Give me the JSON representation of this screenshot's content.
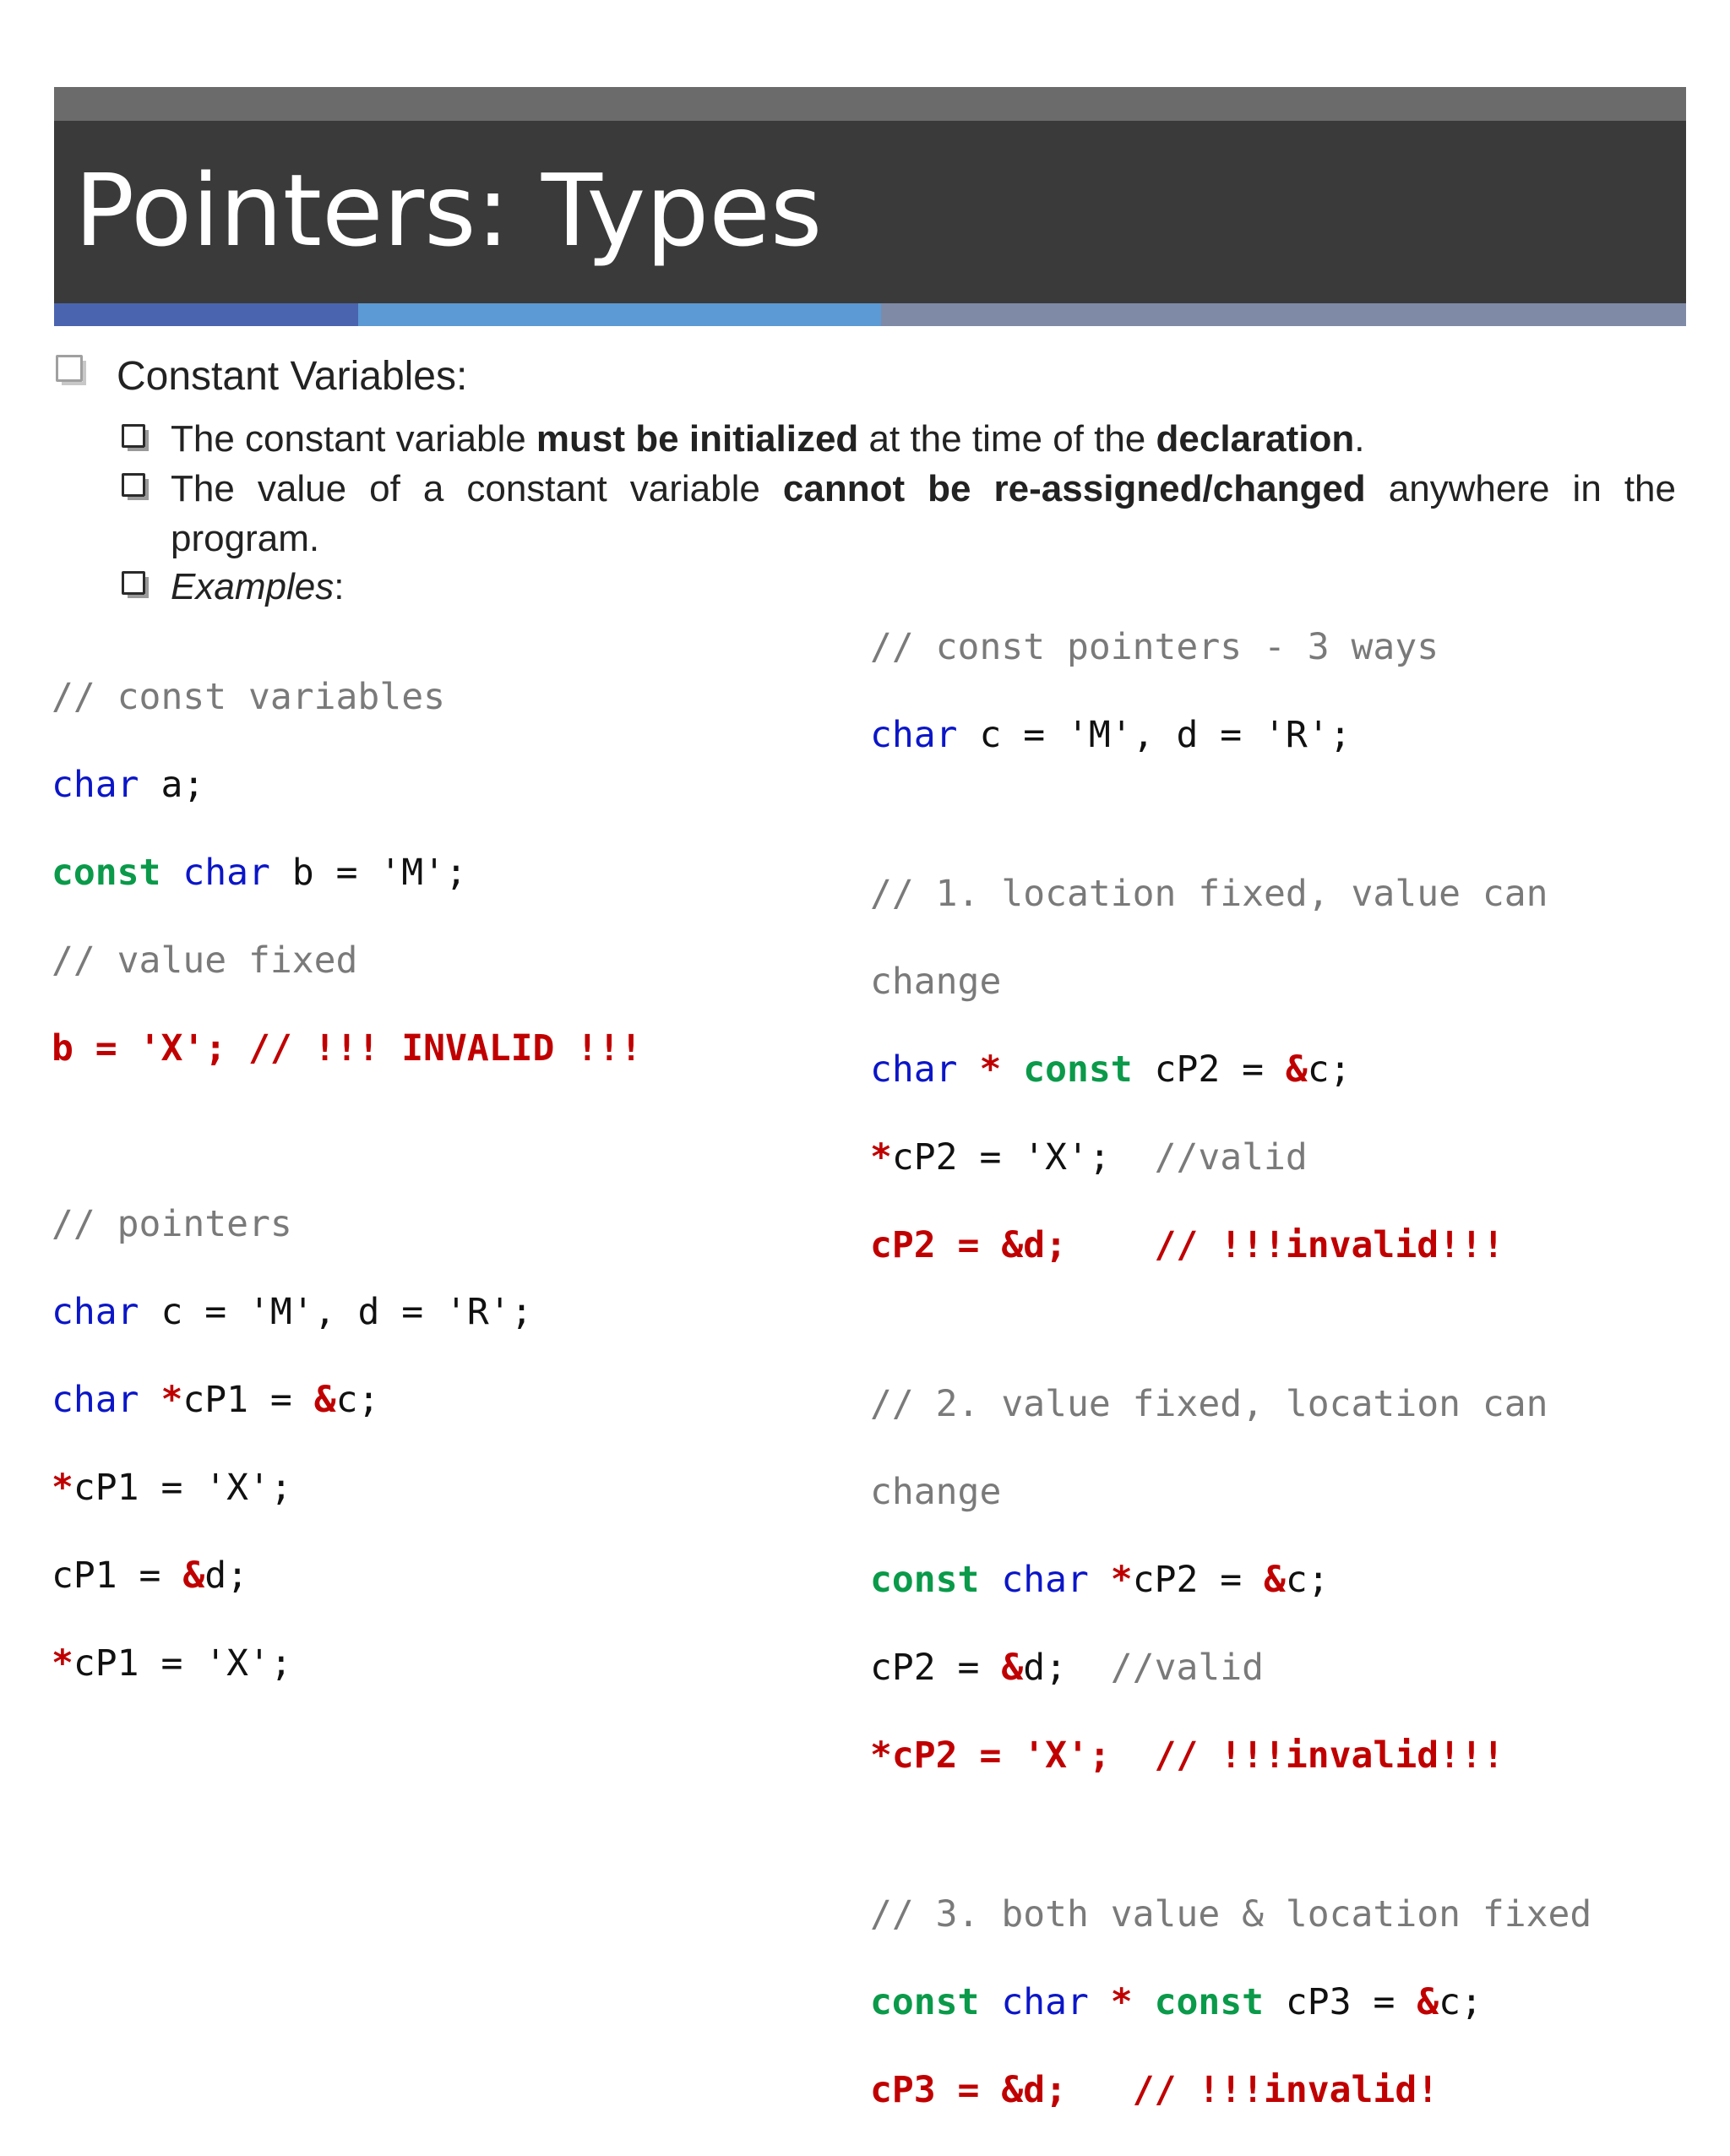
{
  "title": "Pointers: Types",
  "colors": {
    "title_bar": "#3a3a3a",
    "top_band": "#6b6b6b",
    "stripe_1": "#4a64b0",
    "stripe_2": "#5b9ad4",
    "stripe_3": "#7e8aa6",
    "keyword": "#0b16c8",
    "qualifier": "#0a9a4a",
    "error": "#c00000",
    "comment": "#7a7a7a"
  },
  "bullets": {
    "level1": "Constant Variables:",
    "b1": {
      "pre": "The constant variable ",
      "bold1": "must be initialized",
      "mid": " at the time of the ",
      "bold2": "declaration",
      "post": "."
    },
    "b2": {
      "pre": "The value of a constant variable ",
      "bold": "cannot be re-assigned/changed",
      "post": " anywhere in the",
      "line2": "program."
    },
    "b3": {
      "em": "Examples",
      "post": ":"
    }
  },
  "left_code": {
    "c1": "// const variables",
    "l1_kw": "char",
    "l1_rest": " a;",
    "l2_kg": "const",
    "l2_kw": "char",
    "l2_rest": " b = 'M';",
    "c2": "// value fixed",
    "l3_red": "b = 'X'; // !!! INVALID !!!",
    "c3": "// pointers",
    "l4_kw": "char",
    "l4_rest": " c = 'M', d = 'R';",
    "l5_kw": "char",
    "l5_star": "*",
    "l5_mid": "cP1 = ",
    "l5_amp": "&",
    "l5_end": "c;",
    "l6_star": "*",
    "l6_rest": "cP1 = 'X';",
    "l7_pre": "cP1 = ",
    "l7_amp": "&",
    "l7_end": "d;",
    "l8_star": "*",
    "l8_rest": "cP1 = 'X';"
  },
  "right_code": {
    "c1": "// const pointers - 3 ways",
    "r1_kw": "char",
    "r1_rest": " c = 'M', d = 'R';",
    "c2a": "// 1. location fixed, value can",
    "c2b": "change",
    "r2_kw": "char",
    "r2_star": "*",
    "r2_kg": "const",
    "r2_mid": " cP2 = ",
    "r2_amp": "&",
    "r2_end": "c;",
    "r3_star": "*",
    "r3_rest": "cP2 = 'X';  ",
    "r3_cm": "//valid",
    "r4_red": "cP2 = &d;    // !!!invalid!!!",
    "c3a": "// 2. value fixed, location can",
    "c3b": "change",
    "r5_kg": "const",
    "r5_kw": "char",
    "r5_star": "*",
    "r5_mid": "cP2 = ",
    "r5_amp": "&",
    "r5_end": "c;",
    "r6_pre": "cP2 = ",
    "r6_amp": "&",
    "r6_end": "d;  ",
    "r6_cm": "//valid",
    "r7_red": "*cP2 = 'X';  // !!!invalid!!!",
    "c4": "// 3. both value & location fixed",
    "r8_kg": "const",
    "r8_kw": "char",
    "r8_star": "*",
    "r8_kg2": "const",
    "r8_mid": " cP3 = ",
    "r8_amp": "&",
    "r8_end": "c;",
    "r9_red": "cP3 = &d;   // !!!invalid!"
  }
}
